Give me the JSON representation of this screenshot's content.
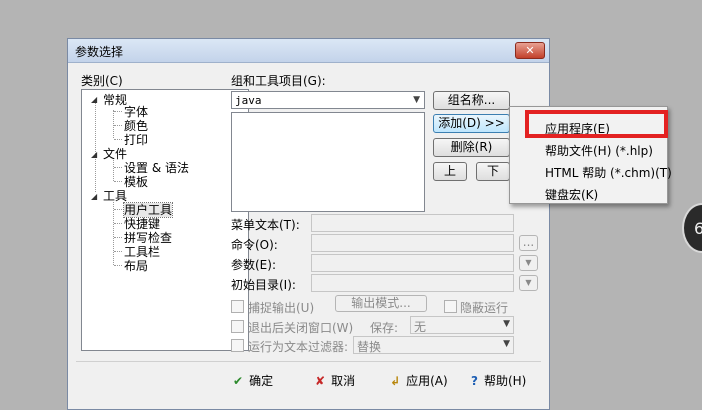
{
  "dialog": {
    "title": "参数选择",
    "close_label": "✕"
  },
  "category": {
    "label": "类别(C)",
    "tree": [
      {
        "label": "常规",
        "children": [
          "字体",
          "颜色",
          "打印"
        ]
      },
      {
        "label": "文件",
        "children": [
          "设置 & 语法",
          "模板"
        ]
      },
      {
        "label": "工具",
        "children": [
          "用户工具",
          "快捷键",
          "拼写检查",
          "工具栏",
          "布局"
        ],
        "selected": "用户工具"
      }
    ]
  },
  "groups": {
    "label": "组和工具项目(G):",
    "selected_group": "java",
    "group_name_button": "组名称...",
    "add_button": "添加(D) >>",
    "delete_button": "删除(R)",
    "up_button": "上",
    "down_button": "下"
  },
  "fields": {
    "menu_text": "菜单文本(T):",
    "command": "命令(O):",
    "params": "参数(E):",
    "init_dir": "初始目录(I):",
    "browse_label": "...",
    "dd_glyph": "▼"
  },
  "options": {
    "capture_output": "捕捉输出(U)",
    "output_mode_button": "输出模式...",
    "hide_run": "隐蔽运行",
    "close_on_exit": "退出后关闭窗口(W)",
    "save_label": "保存:",
    "save_value": "无",
    "text_filter": "运行为文本过滤器:",
    "filter_value": "替换"
  },
  "footer": {
    "ok": "确定",
    "cancel": "取消",
    "apply": "应用(A)",
    "help": "帮助(H)",
    "ok_icon": "✔",
    "cancel_icon": "✘",
    "apply_icon": "↲",
    "help_icon": "?"
  },
  "context_menu": {
    "items": [
      "应用程序(E)",
      "帮助文件(H) (*.hlp)",
      "HTML 帮助 (*.chm)(T)",
      "键盘宏(K)"
    ],
    "highlighted": "应用程序(E)"
  },
  "desktop": {
    "disc_text": "6"
  },
  "colors": {
    "highlight": "#e32222",
    "title_bar": "#c3d3ea"
  }
}
